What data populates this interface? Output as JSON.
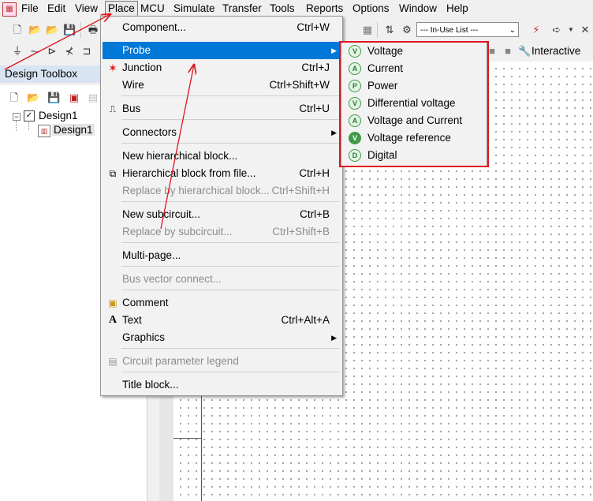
{
  "menubar": {
    "items": [
      "File",
      "Edit",
      "View",
      "Place",
      "MCU",
      "Simulate",
      "Transfer",
      "Tools",
      "Reports",
      "Options",
      "Window",
      "Help"
    ]
  },
  "toolbar": {
    "inuse_list": "--- In-Use List ---",
    "interactive_label": "Interactive"
  },
  "toolbox": {
    "title": "Design Toolbox",
    "tree": {
      "root": "Design1",
      "child": "Design1"
    }
  },
  "place_menu": {
    "items": [
      {
        "label": "Component...",
        "shortcut": "Ctrl+W"
      },
      {
        "label": "Probe",
        "shortcut": ""
      },
      {
        "label": "Junction",
        "shortcut": "Ctrl+J"
      },
      {
        "label": "Wire",
        "shortcut": "Ctrl+Shift+W"
      },
      {
        "label": "Bus",
        "shortcut": "Ctrl+U"
      },
      {
        "label": "Connectors",
        "shortcut": ""
      },
      {
        "label": "New hierarchical block...",
        "shortcut": ""
      },
      {
        "label": "Hierarchical block from file...",
        "shortcut": "Ctrl+H"
      },
      {
        "label": "Replace by hierarchical block...",
        "shortcut": "Ctrl+Shift+H"
      },
      {
        "label": "New subcircuit...",
        "shortcut": "Ctrl+B"
      },
      {
        "label": "Replace by subcircuit...",
        "shortcut": "Ctrl+Shift+B"
      },
      {
        "label": "Multi-page...",
        "shortcut": ""
      },
      {
        "label": "Bus vector connect...",
        "shortcut": ""
      },
      {
        "label": "Comment",
        "shortcut": ""
      },
      {
        "label": "Text",
        "shortcut": "Ctrl+Alt+A"
      },
      {
        "label": "Graphics",
        "shortcut": ""
      },
      {
        "label": "Circuit parameter legend",
        "shortcut": ""
      },
      {
        "label": "Title block...",
        "shortcut": ""
      }
    ]
  },
  "probe_menu": {
    "items": [
      {
        "label": "Voltage",
        "icon": "V"
      },
      {
        "label": "Current",
        "icon": "A"
      },
      {
        "label": "Power",
        "icon": "P"
      },
      {
        "label": "Differential voltage",
        "icon": "V"
      },
      {
        "label": "Voltage and Current",
        "icon": "A"
      },
      {
        "label": "Voltage reference",
        "icon": "V"
      },
      {
        "label": "Digital",
        "icon": "D"
      }
    ]
  },
  "colors": {
    "highlight": "#0078d7",
    "annotation": "#e0141e",
    "probe_icon": "#3f9a4a"
  }
}
